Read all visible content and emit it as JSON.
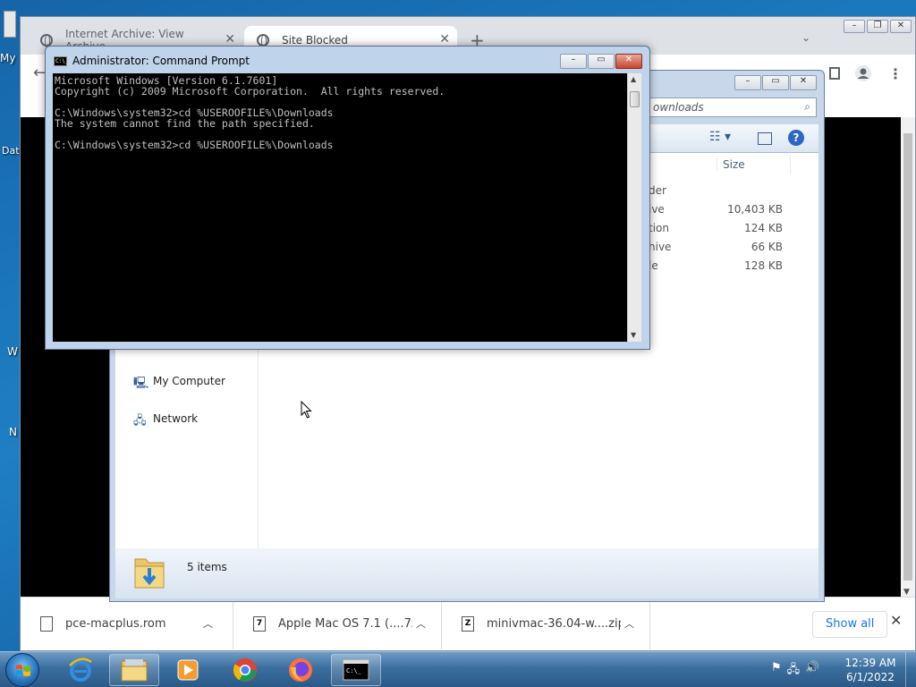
{
  "desktop": {
    "icon_labels": [
      "My",
      "Dat",
      "W",
      "N"
    ]
  },
  "chrome": {
    "tabs": [
      {
        "title": "Internet Archive: View Archive"
      },
      {
        "title": "Site Blocked"
      }
    ],
    "new_tab_glyph": "+",
    "downloads": [
      {
        "name": "pce-macplus.rom",
        "icon": "file-icon"
      },
      {
        "name": "Apple Mac OS 7.1 (....7z",
        "icon": "archive-icon"
      },
      {
        "name": "minivmac-36.04-w....zip",
        "icon": "zip-icon"
      }
    ],
    "show_all_label": "Show all"
  },
  "explorer": {
    "search_placeholder": "ownloads",
    "size_header": "Size",
    "files": [
      {
        "type": "der",
        "size": ""
      },
      {
        "type": "ive",
        "size": "10,403 KB"
      },
      {
        "type": "tion",
        "size": "124 KB"
      },
      {
        "type": "hive",
        "size": "66 KB"
      },
      {
        "type": "le",
        "size": "128 KB"
      }
    ],
    "nav": [
      {
        "label": "My Computer",
        "icon": "computer-icon"
      },
      {
        "label": "Network",
        "icon": "network-icon"
      }
    ],
    "status_count": "5 items"
  },
  "cmd": {
    "title": "Administrator: Command Prompt",
    "icon_text": "C:\\_",
    "lines": [
      "Microsoft Windows [Version 6.1.7601]",
      "Copyright (c) 2009 Microsoft Corporation.  All rights reserved.",
      "",
      "C:\\Windows\\system32>cd %USEROOFILE%\\Downloads",
      "The system cannot find the path specified.",
      "",
      "C:\\Windows\\system32>cd %USEROOFILE%\\Downloads"
    ]
  },
  "taskbar": {
    "apps": [
      "internet-explorer-icon",
      "file-explorer-icon",
      "media-player-icon",
      "chrome-icon",
      "firefox-icon",
      "command-prompt-icon"
    ],
    "time": "12:39 AM",
    "date": "6/1/2022"
  },
  "colors": {
    "desktop": "#1f7fc4",
    "taskbar": "#3b6e9e",
    "link_blue": "#1a73e8"
  }
}
